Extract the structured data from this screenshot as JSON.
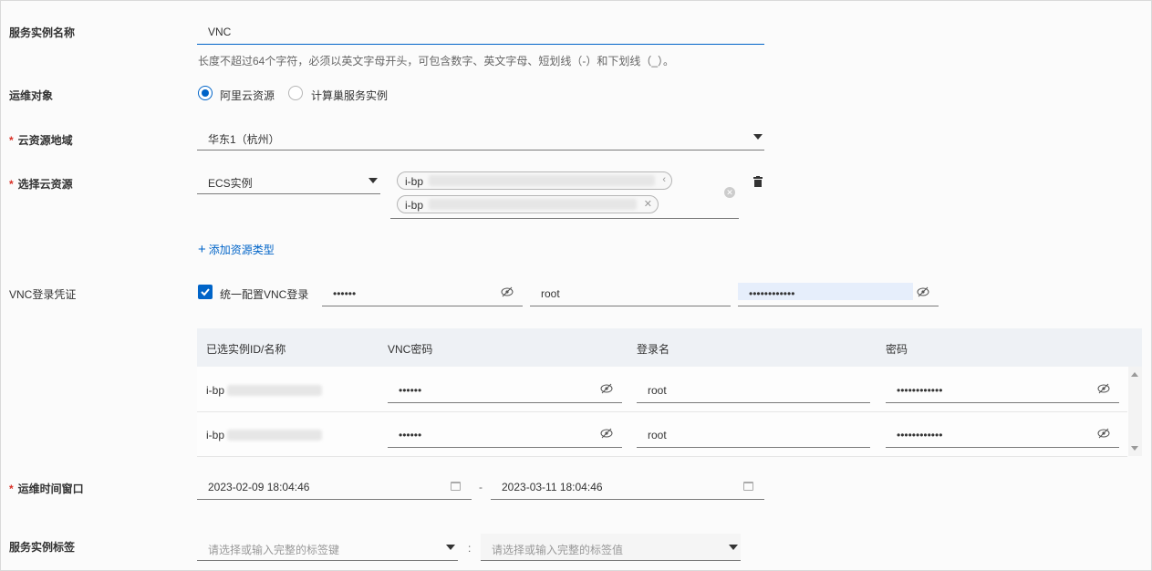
{
  "form": {
    "service_name": {
      "label": "服务实例名称",
      "value": "VNC",
      "help": "长度不超过64个字符，必须以英文字母开头，可包含数字、英文字母、短划线（-）和下划线（_）。"
    },
    "target": {
      "label": "运维对象",
      "options": [
        {
          "label": "阿里云资源",
          "checked": true
        },
        {
          "label": "计算巢服务实例",
          "checked": false
        }
      ]
    },
    "region": {
      "label": "云资源地域",
      "required_mark": "*",
      "value": "华东1（杭州）"
    },
    "resource": {
      "label": "选择云资源",
      "required_mark": "*",
      "type_value": "ECS实例",
      "tags": [
        "i-bp",
        "i-bp"
      ],
      "add_link": "添加资源类型"
    },
    "vnc_credential": {
      "label": "VNC登录凭证",
      "unified_label": "统一配置VNC登录",
      "unified_checked": true,
      "vnc_password": "••••••",
      "login_name": "root",
      "password": "••••••••••••"
    },
    "instances_table": {
      "columns": [
        "已选实例ID/名称",
        "VNC密码",
        "登录名",
        "密码"
      ],
      "rows": [
        {
          "id": "i-bp",
          "vnc_password": "••••••",
          "login": "root",
          "password": "••••••••••••"
        },
        {
          "id": "i-bp",
          "vnc_password": "••••••",
          "login": "root",
          "password": "••••••••••••"
        }
      ]
    },
    "time_window": {
      "label": "运维时间窗口",
      "required_mark": "*",
      "start": "2023-02-09 18:04:46",
      "separator": "-",
      "end": "2023-03-11 18:04:46"
    },
    "tags": {
      "label": "服务实例标签",
      "key_placeholder": "请选择或输入完整的标签键",
      "separator": ":",
      "value_placeholder": "请选择或输入完整的标签值"
    }
  },
  "colors": {
    "accent": "#0064c8",
    "required": "#d93026",
    "table_header": "#eef1f5"
  }
}
